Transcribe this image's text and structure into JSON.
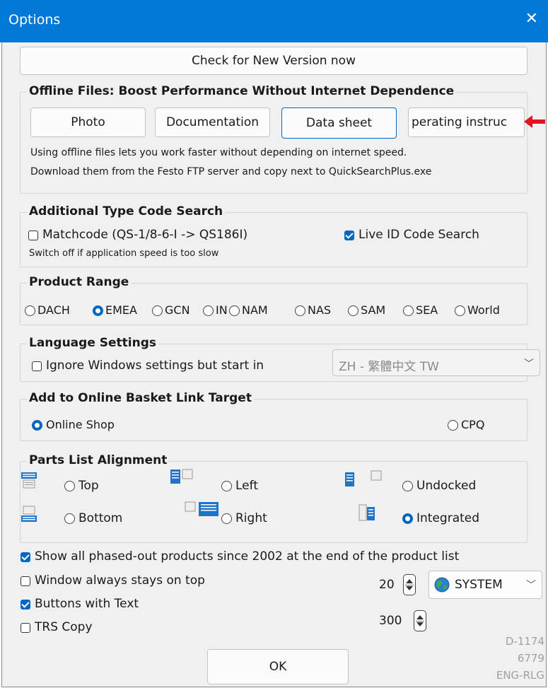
{
  "window": {
    "title": "Options",
    "close_glyph": "✕"
  },
  "check_version_label": "Check for New Version now",
  "offline": {
    "title": "Offline Files: Boost Performance Without Internet Dependence",
    "buttons": [
      "Photo",
      "Documentation",
      "Data sheet",
      "perating instruc"
    ],
    "note1": "Using offline files lets you work faster without depending on internet speed.",
    "note2": "Download them from the Festo FTP server and copy next to QuickSearchPlus.exe"
  },
  "typecode": {
    "title": "Additional Type Code Search",
    "matchcode_label": "Matchcode (QS-1/8-6-I  ->  QS186I)",
    "matchcode_checked": false,
    "liveid_label": "Live ID Code Search",
    "liveid_checked": true,
    "hint": "Switch off if application speed is too slow"
  },
  "range": {
    "title": "Product Range",
    "options": [
      "DACH",
      "EMEA",
      "GCN",
      "IN",
      "NAM",
      "NAS",
      "SAM",
      "SEA",
      "World"
    ],
    "selected": "EMEA"
  },
  "language": {
    "title": "Language Settings",
    "ignore_label": "Ignore Windows settings but start in",
    "ignore_checked": false,
    "selected_value": "ZH - 繁體中文 TW"
  },
  "basket": {
    "title": "Add to Online Basket Link Target",
    "online_label": "Online Shop",
    "cpq_label": "CPQ",
    "selected": "Online Shop"
  },
  "parts": {
    "title": "Parts List Alignment",
    "top_label": "Top",
    "left_label": "Left",
    "undocked_label": "Undocked",
    "bottom_label": "Bottom",
    "right_label": "Right",
    "integrated_label": "Integrated",
    "selected": "Integrated"
  },
  "misc": {
    "phased_label": "Show all phased-out products since 2002 at the end of the product list",
    "phased_checked": true,
    "ontop_label": "Window always stays on top",
    "ontop_checked": false,
    "buttons_text_label": "Buttons with Text",
    "buttons_text_checked": true,
    "trs_label": "TRS Copy",
    "trs_checked": false
  },
  "spinners": {
    "first": "20",
    "second": "300"
  },
  "system_combo": {
    "value": "SYSTEM"
  },
  "ok_label": "OK",
  "version": {
    "line1": "D-1174",
    "line2": "6779",
    "line3": "ENG-RLG"
  },
  "colors": {
    "title_bar": "#0078d7",
    "accent": "#0067c0",
    "arrow": "#e81123"
  }
}
